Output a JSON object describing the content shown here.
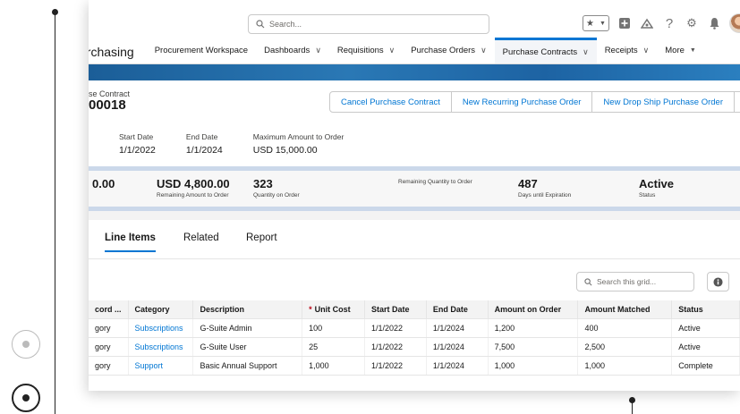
{
  "header": {
    "search_placeholder": "Search...",
    "icons": [
      "star-icon",
      "chevron-down-icon",
      "add-icon",
      "trailhead-icon",
      "help-icon",
      "gear-icon",
      "bell-icon",
      "avatar"
    ]
  },
  "nav": {
    "app_name": "urchasing",
    "items": [
      {
        "label": "Procurement Workspace",
        "chevron": false
      },
      {
        "label": "Dashboards",
        "chevron": true
      },
      {
        "label": "Requisitions",
        "chevron": true
      },
      {
        "label": "Purchase Orders",
        "chevron": true
      },
      {
        "label": "Purchase Contracts",
        "chevron": true,
        "active": true
      },
      {
        "label": "Receipts",
        "chevron": true
      },
      {
        "label": "More",
        "chevron": true
      }
    ],
    "chevron_glyph": "∨",
    "more_glyph": "▼"
  },
  "record": {
    "object_label": "se Contract",
    "name": "00018",
    "actions": {
      "cancel": "Cancel Purchase Contract",
      "recurring": "New Recurring Purchase Order",
      "dropship": "New Drop Ship Purchase Order",
      "menu": "▼"
    },
    "fields": [
      {
        "label": "Start Date",
        "value": "1/1/2022"
      },
      {
        "label": "End Date",
        "value": "1/1/2024"
      },
      {
        "label": "Maximum Amount to Order",
        "value": "USD 15,000.00"
      }
    ]
  },
  "summary": {
    "first_value": "0.00",
    "metrics": [
      {
        "value": "USD 4,800.00",
        "caption": "Remaining Amount to Order"
      },
      {
        "value": "323",
        "caption": "Quantity on Order"
      },
      {
        "value": "",
        "caption": "Remaining Quantity to Order"
      },
      {
        "value": "487",
        "caption": "Days until Expiration"
      },
      {
        "value": "Active",
        "caption": "Status"
      }
    ]
  },
  "tabs": [
    "Line Items",
    "Related",
    "Report"
  ],
  "grid": {
    "search_placeholder": "Search this grid...",
    "columns": [
      "cord ...",
      "Category",
      "Description",
      "Unit Cost",
      "Start Date",
      "End Date",
      "Amount on Order",
      "Amount Matched",
      "Status"
    ],
    "required_marker": "*",
    "rows": [
      [
        "gory",
        "Subscriptions",
        "G-Suite Admin",
        "100",
        "1/1/2022",
        "1/1/2024",
        "1,200",
        "400",
        "Active"
      ],
      [
        "gory",
        "Subscriptions",
        "G-Suite User",
        "25",
        "1/1/2022",
        "1/1/2024",
        "7,500",
        "2,500",
        "Active"
      ],
      [
        "gory",
        "Support",
        "Basic Annual Support",
        "1,000",
        "1/1/2022",
        "1/1/2024",
        "1,000",
        "1,000",
        "Complete"
      ]
    ]
  },
  "colors": {
    "brand": "#0176d3",
    "banner": "#1b5e98",
    "required": "#ba0517"
  }
}
